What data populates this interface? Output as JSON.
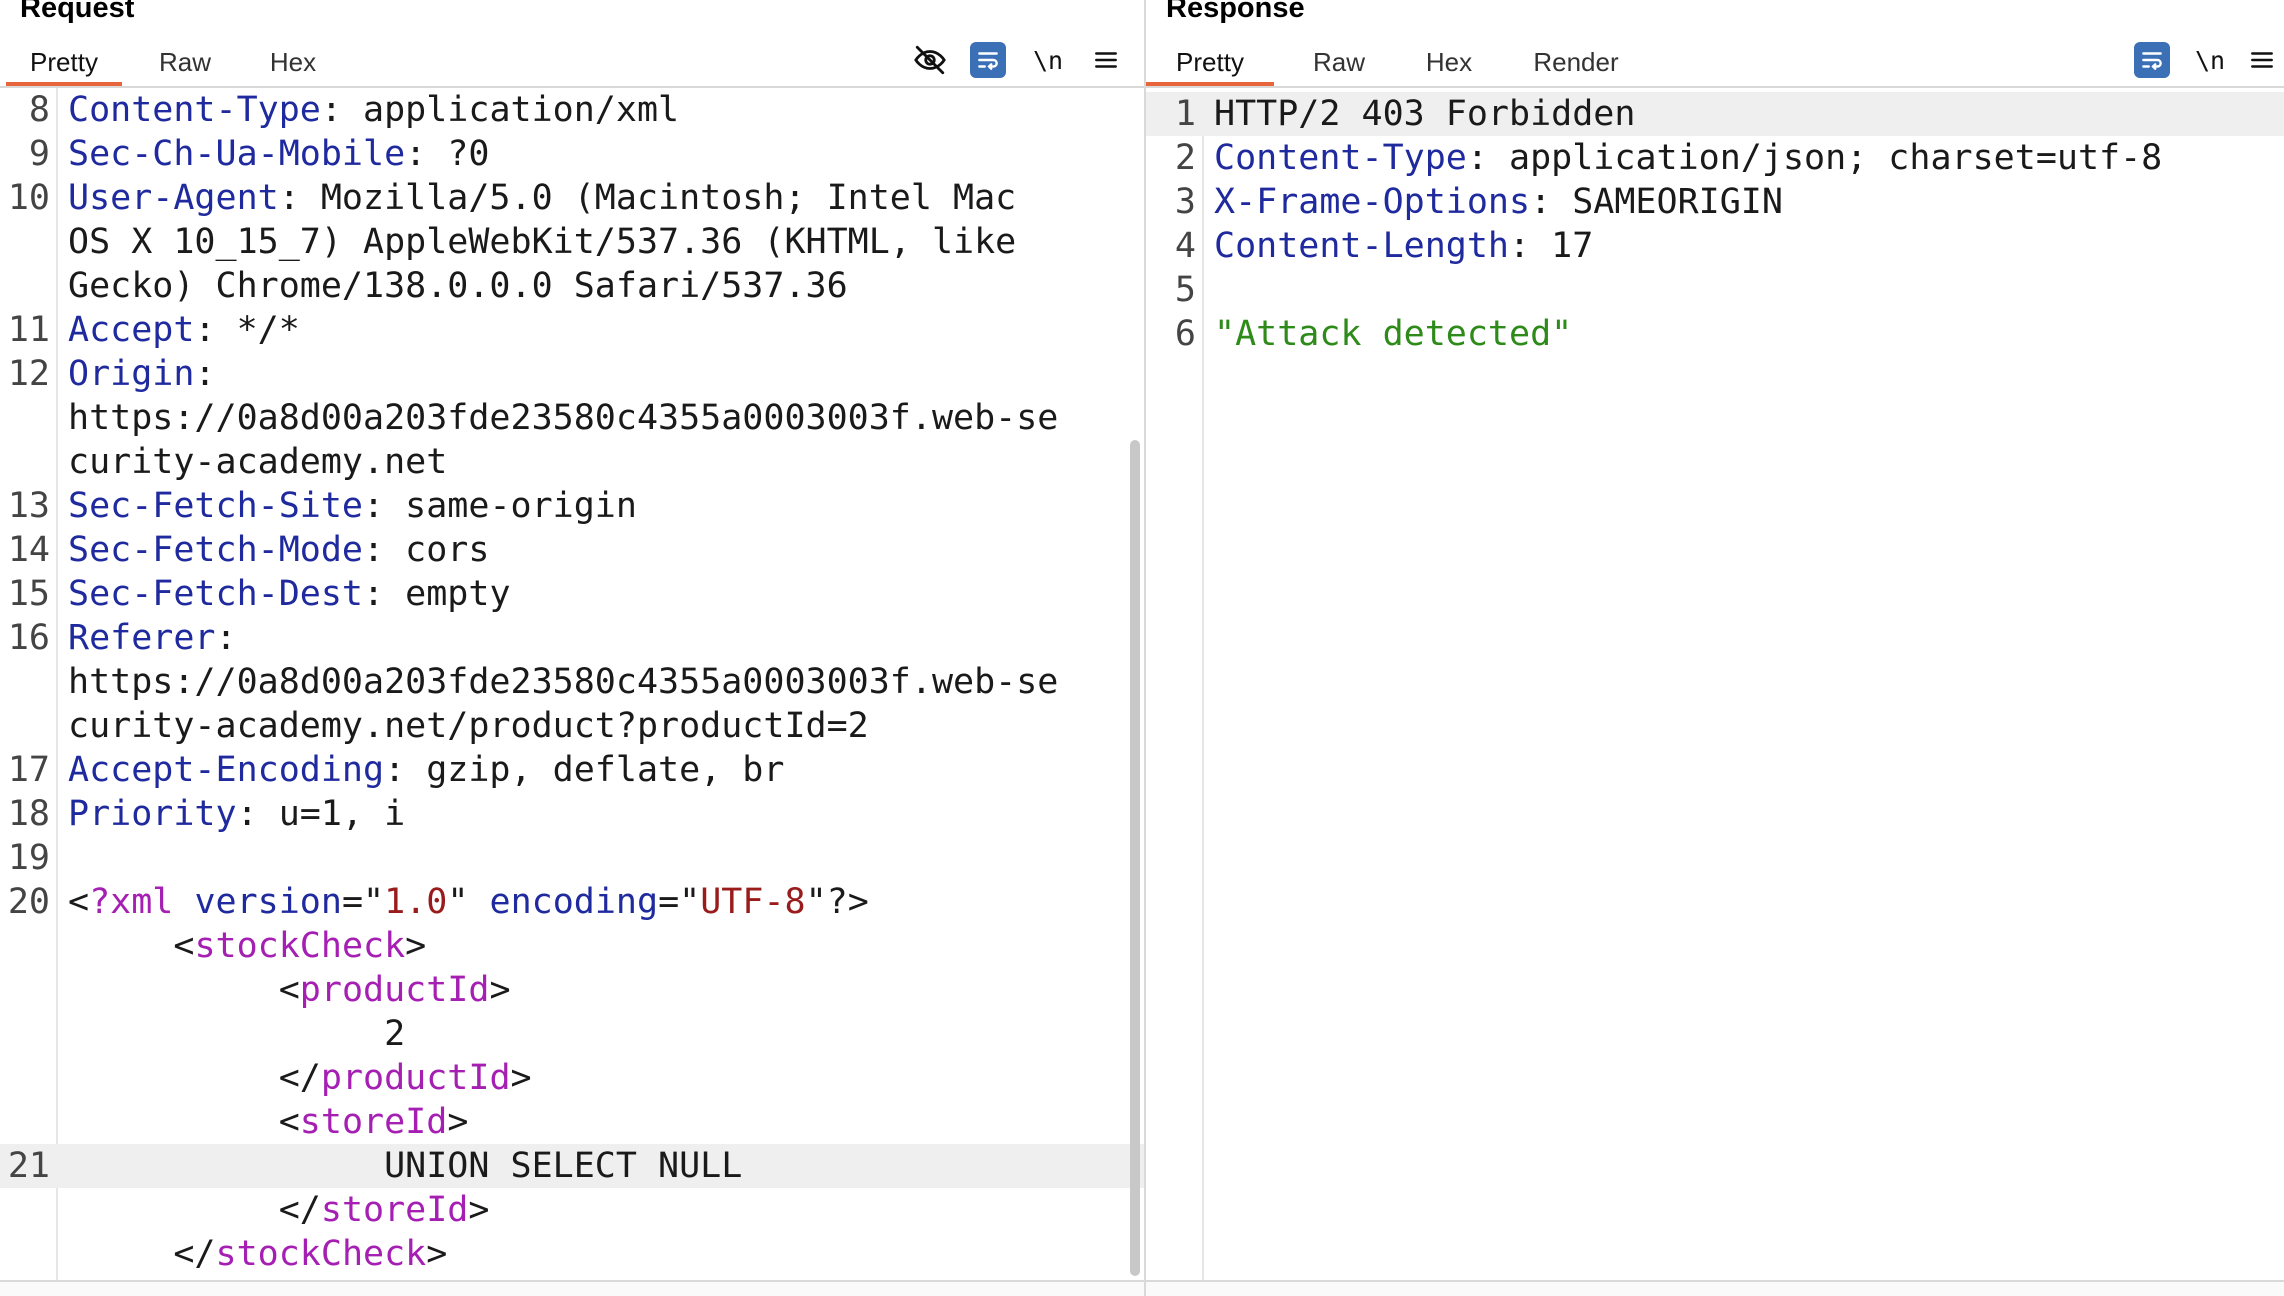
{
  "request": {
    "title": "Request",
    "tabs": [
      "Pretty",
      "Raw",
      "Hex"
    ],
    "active_tab": "Pretty",
    "toolbar": {
      "newline_label": "\\n"
    },
    "lines": [
      {
        "n": "8",
        "parts": [
          {
            "t": "Content-Type",
            "c": "hn"
          },
          {
            "t": ": application/xml"
          }
        ]
      },
      {
        "n": "9",
        "parts": [
          {
            "t": "Sec-Ch-Ua-Mobile",
            "c": "hn"
          },
          {
            "t": ": ?0"
          }
        ]
      },
      {
        "n": "10",
        "parts": [
          {
            "t": "User-Agent",
            "c": "hn"
          },
          {
            "t": ": Mozilla/5.0 (Macintosh; Intel Mac"
          }
        ]
      },
      {
        "n": "",
        "parts": [
          {
            "t": "OS X 10_15_7) AppleWebKit/537.36 (KHTML, like"
          }
        ]
      },
      {
        "n": "",
        "parts": [
          {
            "t": "Gecko) Chrome/138.0.0.0 Safari/537.36"
          }
        ]
      },
      {
        "n": "11",
        "parts": [
          {
            "t": "Accept",
            "c": "hn"
          },
          {
            "t": ": */*"
          }
        ]
      },
      {
        "n": "12",
        "parts": [
          {
            "t": "Origin",
            "c": "hn"
          },
          {
            "t": ":"
          }
        ]
      },
      {
        "n": "",
        "parts": [
          {
            "t": "https://0a8d00a203fde23580c4355a0003003f.web-se"
          }
        ]
      },
      {
        "n": "",
        "parts": [
          {
            "t": "curity-academy.net"
          }
        ]
      },
      {
        "n": "13",
        "parts": [
          {
            "t": "Sec-Fetch-Site",
            "c": "hn"
          },
          {
            "t": ": same-origin"
          }
        ]
      },
      {
        "n": "14",
        "parts": [
          {
            "t": "Sec-Fetch-Mode",
            "c": "hn"
          },
          {
            "t": ": cors"
          }
        ]
      },
      {
        "n": "15",
        "parts": [
          {
            "t": "Sec-Fetch-Dest",
            "c": "hn"
          },
          {
            "t": ": empty"
          }
        ]
      },
      {
        "n": "16",
        "parts": [
          {
            "t": "Referer",
            "c": "hn"
          },
          {
            "t": ":"
          }
        ]
      },
      {
        "n": "",
        "parts": [
          {
            "t": "https://0a8d00a203fde23580c4355a0003003f.web-se"
          }
        ]
      },
      {
        "n": "",
        "parts": [
          {
            "t": "curity-academy.net/product?productId=2"
          }
        ]
      },
      {
        "n": "17",
        "parts": [
          {
            "t": "Accept-Encoding",
            "c": "hn"
          },
          {
            "t": ": gzip, deflate, br"
          }
        ]
      },
      {
        "n": "18",
        "parts": [
          {
            "t": "Priority",
            "c": "hn"
          },
          {
            "t": ": u=1, i"
          }
        ]
      },
      {
        "n": "19",
        "parts": []
      },
      {
        "n": "20",
        "parts": [
          {
            "t": "<"
          },
          {
            "t": "?xml",
            "c": "tg"
          },
          {
            "t": " "
          },
          {
            "t": "version",
            "c": "hn"
          },
          {
            "t": "=\""
          },
          {
            "t": "1.0",
            "c": "av"
          },
          {
            "t": "\" "
          },
          {
            "t": "encoding",
            "c": "hn"
          },
          {
            "t": "=\""
          },
          {
            "t": "UTF-8",
            "c": "av"
          },
          {
            "t": "\"?>"
          }
        ]
      },
      {
        "n": "",
        "parts": [
          {
            "t": "     <"
          },
          {
            "t": "stockCheck",
            "c": "tg"
          },
          {
            "t": ">"
          }
        ]
      },
      {
        "n": "",
        "parts": [
          {
            "t": "          <"
          },
          {
            "t": "productId",
            "c": "tg"
          },
          {
            "t": ">"
          }
        ]
      },
      {
        "n": "",
        "parts": [
          {
            "t": "               2"
          }
        ]
      },
      {
        "n": "",
        "parts": [
          {
            "t": "          </"
          },
          {
            "t": "productId",
            "c": "tg"
          },
          {
            "t": ">"
          }
        ]
      },
      {
        "n": "",
        "parts": [
          {
            "t": "          <"
          },
          {
            "t": "storeId",
            "c": "tg"
          },
          {
            "t": ">"
          }
        ]
      },
      {
        "n": "21",
        "hl": true,
        "parts": [
          {
            "t": "               UNION SELECT NULL"
          }
        ]
      },
      {
        "n": "",
        "parts": [
          {
            "t": "          </"
          },
          {
            "t": "storeId",
            "c": "tg"
          },
          {
            "t": ">"
          }
        ]
      },
      {
        "n": "",
        "parts": [
          {
            "t": "     </"
          },
          {
            "t": "stockCheck",
            "c": "tg"
          },
          {
            "t": ">"
          }
        ]
      }
    ]
  },
  "response": {
    "title": "Response",
    "tabs": [
      "Pretty",
      "Raw",
      "Hex",
      "Render"
    ],
    "active_tab": "Pretty",
    "toolbar": {
      "newline_label": "\\n"
    },
    "lines": [
      {
        "n": "1",
        "hl": true,
        "parts": [
          {
            "t": "HTTP/2 403 Forbidden"
          }
        ]
      },
      {
        "n": "2",
        "parts": [
          {
            "t": "Content-Type",
            "c": "hn"
          },
          {
            "t": ": application/json; charset=utf-8"
          }
        ]
      },
      {
        "n": "3",
        "parts": [
          {
            "t": "X-Frame-Options",
            "c": "hn"
          },
          {
            "t": ": SAMEORIGIN"
          }
        ]
      },
      {
        "n": "4",
        "parts": [
          {
            "t": "Content-Length",
            "c": "hn"
          },
          {
            "t": ": 17"
          }
        ]
      },
      {
        "n": "5",
        "parts": []
      },
      {
        "n": "6",
        "parts": [
          {
            "t": "\"Attack detected\"",
            "c": "st"
          }
        ]
      }
    ]
  },
  "colors": {
    "accent": "#e8643a",
    "header_name": "#1f2a9e",
    "tag": "#a51fb3",
    "attr_value": "#9a1b1b",
    "string": "#2e8b1a",
    "wrap_button": "#3b6fb6"
  },
  "icons": [
    "eye-off-icon",
    "word-wrap-icon",
    "newline-icon",
    "menu-icon"
  ]
}
